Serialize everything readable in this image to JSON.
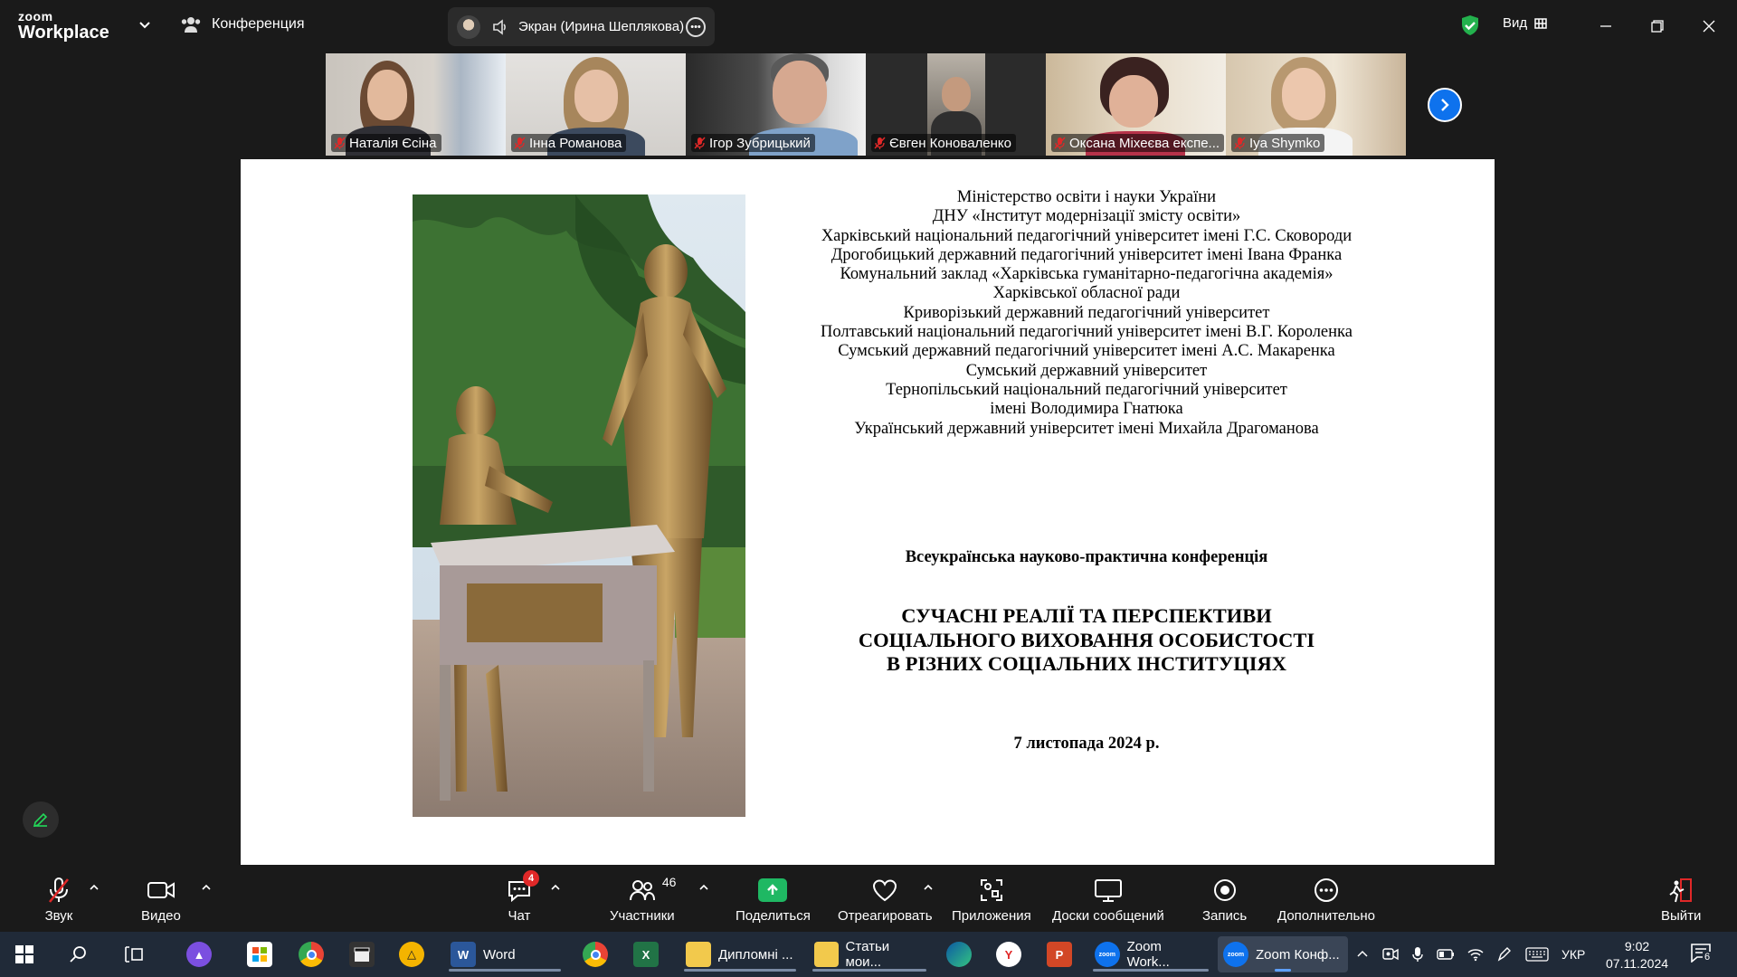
{
  "window": {
    "logo_line1": "zoom",
    "logo_line2": "Workplace",
    "meeting_label": "Конференция",
    "share_label": "Экран (Ирина Шеплякова)",
    "view_label": "Вид"
  },
  "participants": [
    {
      "name": "Наталія Єсіна",
      "muted": true,
      "active": false
    },
    {
      "name": "Інна Романова",
      "muted": true,
      "active": true
    },
    {
      "name": "Ігор Зубрицький",
      "muted": true,
      "active": false
    },
    {
      "name": "Євген Коноваленко",
      "muted": true,
      "active": false
    },
    {
      "name": "Оксана Міхеєва експе...",
      "muted": true,
      "active": false
    },
    {
      "name": "Iya Shymko",
      "muted": true,
      "active": false
    }
  ],
  "slide": {
    "organizations": [
      "Міністерство освіти і науки України",
      "ДНУ «Інститут модернізації змісту освіти»",
      "Харківський національний педагогічний університет імені Г.С. Сковороди",
      "Дрогобицький державний педагогічний університет імені Івана Франка",
      "Комунальний заклад «Харківська гуманітарно-педагогічна академія»",
      "Харківської обласної ради",
      "Криворізький державний педагогічний університет",
      "Полтавський національний педагогічний університет імені В.Г. Короленка",
      "Сумський державний педагогічний університет імені А.С. Макаренка",
      "Сумський державний університет",
      "Тернопільський національний педагогічний університет",
      "імені Володимира Гнатюка",
      "Український державний університет імені Михайла Драгоманова"
    ],
    "conference_type": "Всеукраїнська науково-практична конференція",
    "title_lines": [
      "СУЧАСНІ РЕАЛІЇ ТА ПЕРСПЕКТИВИ",
      "СОЦІАЛЬНОГО ВИХОВАННЯ ОСОБИСТОСТІ",
      "В РІЗНИХ СОЦІАЛЬНИХ ІНСТИТУЦІЯХ"
    ],
    "date": "7 листопада 2024 р."
  },
  "toolbar": {
    "audio": "Звук",
    "video": "Видео",
    "chat": "Чат",
    "chat_badge": "4",
    "participants": "Участники",
    "participants_count": "46",
    "share": "Поделиться",
    "react": "Отреагировать",
    "apps": "Приложения",
    "whiteboards": "Доски сообщений",
    "record": "Запись",
    "more": "Дополнительно",
    "leave": "Выйти"
  },
  "taskbar": {
    "word": "Word",
    "folder1": "Дипломні ...",
    "folder2": "Статьи мои...",
    "zoom1": "Zoom Work...",
    "zoom2": "Zoom Конф...",
    "lang": "УКР",
    "time": "9:02",
    "date": "07.11.2024",
    "notifications": "6"
  },
  "colors": {
    "accent_green": "#23d959",
    "share_green": "#1fb863",
    "zoom_blue": "#0e72ed",
    "muted_red": "#e02828",
    "taskbar_bg": "#202a38",
    "app_bg": "#1a1a1a"
  }
}
